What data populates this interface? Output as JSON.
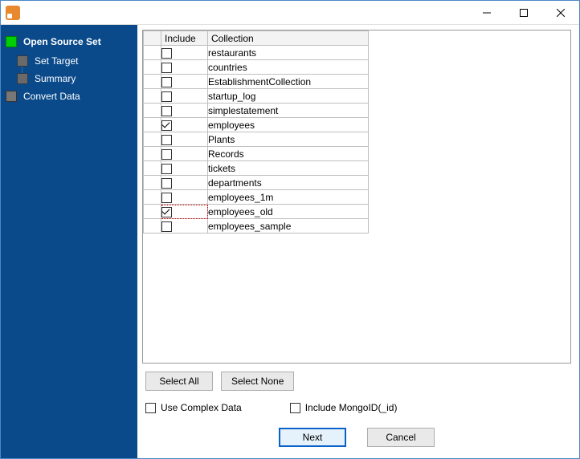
{
  "window": {
    "title": ""
  },
  "sidebar": {
    "steps": [
      {
        "label": "Open Source Set",
        "active": true,
        "children": [
          {
            "label": "Set Target"
          },
          {
            "label": "Summary"
          }
        ]
      },
      {
        "label": "Convert Data",
        "active": false
      }
    ]
  },
  "grid": {
    "headers": {
      "include": "Include",
      "collection": "Collection"
    },
    "rows": [
      {
        "include": false,
        "name": "restaurants",
        "selected": false
      },
      {
        "include": false,
        "name": "countries",
        "selected": false
      },
      {
        "include": false,
        "name": "EstablishmentCollection",
        "selected": false
      },
      {
        "include": false,
        "name": "startup_log",
        "selected": false
      },
      {
        "include": false,
        "name": "simplestatement",
        "selected": false
      },
      {
        "include": true,
        "name": "employees",
        "selected": false
      },
      {
        "include": false,
        "name": "Plants",
        "selected": false
      },
      {
        "include": false,
        "name": "Records",
        "selected": false
      },
      {
        "include": false,
        "name": "tickets",
        "selected": false
      },
      {
        "include": false,
        "name": "departments",
        "selected": false
      },
      {
        "include": false,
        "name": "employees_1m",
        "selected": false
      },
      {
        "include": true,
        "name": "employees_old",
        "selected": true
      },
      {
        "include": false,
        "name": "employees_sample",
        "selected": false
      }
    ]
  },
  "buttons": {
    "selectAll": "Select All",
    "selectNone": "Select None",
    "next": "Next",
    "cancel": "Cancel"
  },
  "options": {
    "useComplexData": {
      "label": "Use Complex Data",
      "checked": false
    },
    "includeMongoId": {
      "label": "Include MongoID(_id)",
      "checked": false
    }
  }
}
